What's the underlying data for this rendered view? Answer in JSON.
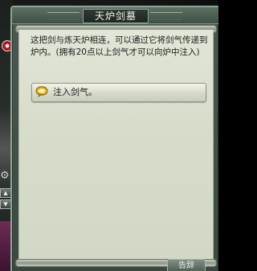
{
  "window": {
    "title": "天炉剑墓"
  },
  "dialog": {
    "description": "这把剑与炼天炉相连，可以通过它将剑气传递到炉内。(拥有20点以上剑气才可以向炉中注入)",
    "options": [
      {
        "label": "注入剑气。",
        "icon": "speech-bubble-icon"
      }
    ]
  },
  "bottom_button": {
    "label": "告辞"
  },
  "side_widgets": {
    "up": "▲",
    "down": "▼",
    "gear": "⚙"
  },
  "colors": {
    "parchment": "#dce1d0",
    "frame": "#44534a",
    "option_icon": "#e7b61c"
  }
}
